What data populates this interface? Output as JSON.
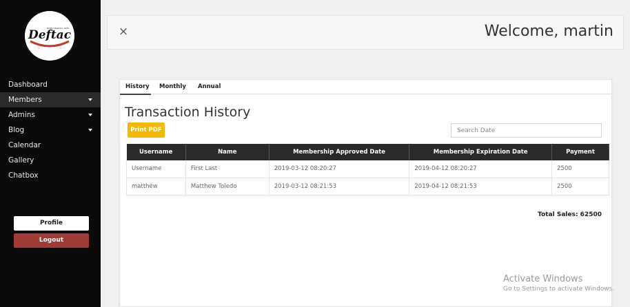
{
  "logo": {
    "text": "Deftac",
    "sub": "MIXED MARTIAL ARTS"
  },
  "sidebar": {
    "items": [
      {
        "label": "Dashboard",
        "caret": false
      },
      {
        "label": "Members",
        "caret": true
      },
      {
        "label": "Admins",
        "caret": true
      },
      {
        "label": "Blog",
        "caret": true
      },
      {
        "label": "Calendar",
        "caret": false
      },
      {
        "label": "Gallery",
        "caret": false
      },
      {
        "label": "Chatbox",
        "caret": false
      }
    ],
    "profile_label": "Profile",
    "logout_label": "Logout"
  },
  "header": {
    "close_symbol": "×",
    "welcome": "Welcome, martin"
  },
  "tabs": [
    "History",
    "Monthly",
    "Annual"
  ],
  "main": {
    "title": "Transaction History",
    "print_label": "Print PDF",
    "search_placeholder": "Search Date",
    "columns": [
      "Username",
      "Name",
      "Membership Approved Date",
      "Membership Expiration Date",
      "Payment"
    ],
    "rows": [
      [
        "Username",
        "First Last",
        "2019-03-12 08:20:27",
        "2019-04-12 08:20:27",
        "2500"
      ],
      [
        "matthew",
        "Matthew Toledo",
        "2019-03-12 08:21:53",
        "2019-04-12 08:21:53",
        "2500"
      ]
    ],
    "total_sales": "Total Sales: 62500"
  },
  "watermark": {
    "line1": "Activate Windows",
    "line2": "Go to Settings to activate Windows."
  },
  "colors": {
    "sidebar_bg": "#0a0a0a",
    "accent_yellow": "#f5b800",
    "logout_red": "#a33a3a",
    "table_header_bg": "#2a2a2a"
  }
}
